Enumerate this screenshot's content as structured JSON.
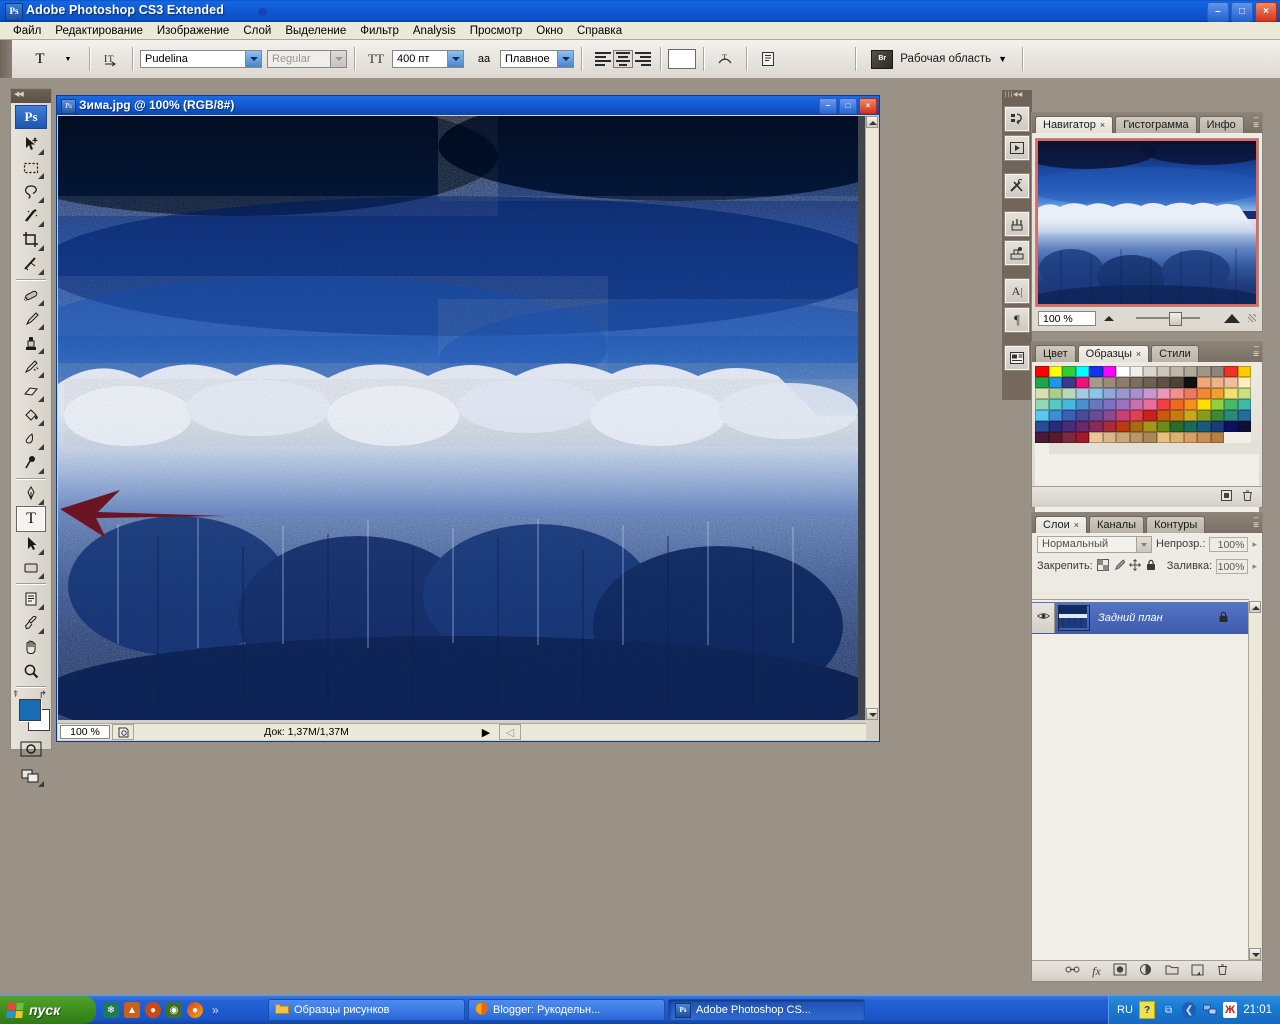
{
  "window": {
    "title": "Adobe Photoshop CS3 Extended",
    "logo": "Ps",
    "minimize": "–",
    "maximize": "□",
    "close": "×"
  },
  "menubar": {
    "items": [
      {
        "label": "Файл"
      },
      {
        "label": "Редактирование"
      },
      {
        "label": "Изображение"
      },
      {
        "label": "Слой"
      },
      {
        "label": "Выделение"
      },
      {
        "label": "Фильтр"
      },
      {
        "label": "Analysis"
      },
      {
        "label": "Просмотр"
      },
      {
        "label": "Окно"
      },
      {
        "label": "Справка"
      }
    ]
  },
  "options_bar": {
    "tool_icon": "T",
    "tool_dropdown_arrow": "▼",
    "orientation_icon": "text-orientation",
    "font_family": "Pudelina",
    "font_style": "Regular",
    "size_icon": "TT",
    "font_size": "400 пт",
    "antialias_icon": "aa",
    "antialias": "Плавное",
    "align_left": "align-left",
    "align_center": "align-center",
    "align_right": "align-right",
    "color_swatch": "#ffffff",
    "warp_icon": "warp-text",
    "palette_icon": "character-palette",
    "bridge_icon": "Br",
    "workspace_label": "Рабочая область",
    "workspace_arrow": "▼"
  },
  "toolbox": {
    "logo": "Ps",
    "tools": [
      {
        "name": "move-tool",
        "glyph": "⬈",
        "selected": false,
        "group": 0
      },
      {
        "name": "marquee-tool",
        "glyph": "⬚",
        "selected": false,
        "group": 0
      },
      {
        "name": "lasso-tool",
        "glyph": "⥁",
        "selected": false,
        "group": 0
      },
      {
        "name": "magic-wand-tool",
        "glyph": "✱",
        "selected": false,
        "group": 0
      },
      {
        "name": "crop-tool",
        "glyph": "⯀",
        "selected": false,
        "group": 0
      },
      {
        "name": "slice-tool",
        "glyph": "∕",
        "selected": false,
        "group": 0
      },
      {
        "name": "healing-brush-tool",
        "glyph": "✒",
        "selected": false,
        "group": 1
      },
      {
        "name": "brush-tool",
        "glyph": "✎",
        "selected": false,
        "group": 1
      },
      {
        "name": "clone-stamp-tool",
        "glyph": "⎘",
        "selected": false,
        "group": 1
      },
      {
        "name": "history-brush-tool",
        "glyph": "✍",
        "selected": false,
        "group": 1
      },
      {
        "name": "eraser-tool",
        "glyph": "▱",
        "selected": false,
        "group": 1
      },
      {
        "name": "gradient-tool",
        "glyph": "◨",
        "selected": false,
        "group": 1
      },
      {
        "name": "blur-tool",
        "glyph": "◖",
        "selected": false,
        "group": 1
      },
      {
        "name": "dodge-tool",
        "glyph": "⚫",
        "selected": false,
        "group": 1
      },
      {
        "name": "pen-tool",
        "glyph": "✑",
        "selected": false,
        "group": 2
      },
      {
        "name": "type-tool",
        "glyph": "T",
        "selected": true,
        "group": 2
      },
      {
        "name": "path-selection-tool",
        "glyph": "➤",
        "selected": false,
        "group": 2
      },
      {
        "name": "rectangle-tool",
        "glyph": "▭",
        "selected": false,
        "group": 2
      },
      {
        "name": "notes-tool",
        "glyph": "Ὕ2",
        "selected": false,
        "group": 3
      },
      {
        "name": "eyedropper-tool",
        "glyph": "⚗",
        "selected": false,
        "group": 3
      },
      {
        "name": "hand-tool",
        "glyph": "✋",
        "selected": false,
        "group": 3
      },
      {
        "name": "zoom-tool",
        "glyph": "⚲",
        "selected": false,
        "group": 3
      }
    ],
    "foreground_color": "#1a6cb5",
    "background_color": "#ffffff",
    "quickmask_icon": "quick-mask-mode",
    "screenmode_icon": "screen-mode"
  },
  "document": {
    "title": "Зима.jpg @ 100% (RGB/8#)",
    "icon": "Ps",
    "minimize": "–",
    "restore": "□",
    "close": "×",
    "zoom": "100 %",
    "doc_info": "Док: 1,37M/1,37M",
    "play_arrow": "▶",
    "image_alt": "winter-forest-photo"
  },
  "dock_strip": {
    "collapse_icon": "◀◀",
    "buttons": [
      {
        "name": "history-panel-icon",
        "glyph": "↺"
      },
      {
        "name": "actions-panel-icon",
        "glyph": "▶"
      },
      {
        "name": "tool-presets-panel-icon",
        "glyph": "✂"
      },
      {
        "name": "brushes-panel-icon",
        "glyph": "⚘"
      },
      {
        "name": "clone-source-panel-icon",
        "glyph": "⚒"
      },
      {
        "name": "character-panel-icon",
        "glyph": "A"
      },
      {
        "name": "paragraph-panel-icon",
        "glyph": "¶"
      },
      {
        "name": "layer-comps-panel-icon",
        "glyph": "▤"
      }
    ]
  },
  "navigator_panel": {
    "tabs": [
      {
        "label": "Навигатор",
        "active": true,
        "close": "×"
      },
      {
        "label": "Гистограмма",
        "active": false,
        "close": ""
      },
      {
        "label": "Инфо",
        "active": false,
        "close": ""
      }
    ],
    "zoom_value": "100 %",
    "menu_icon": "≡",
    "minimize_icon": "–",
    "close_icon": "×",
    "view_box_color": "#e8645a"
  },
  "swatches_panel": {
    "tabs": [
      {
        "label": "Цвет",
        "active": false,
        "close": ""
      },
      {
        "label": "Образцы",
        "active": true,
        "close": "×"
      },
      {
        "label": "Стили",
        "active": false,
        "close": ""
      }
    ],
    "menu_icon": "≡",
    "minimize_icon": "–",
    "close_icon": "×",
    "new_swatch_icon": "▣",
    "delete_swatch_icon": "Ὕ1",
    "colors": [
      "#ff0000",
      "#ffff00",
      "#33cc33",
      "#00ffff",
      "#1133ee",
      "#ff00ff",
      "#ffffff",
      "#f2f0ec",
      "#dcd7cd",
      "#cdc7bb",
      "#beb7aa",
      "#b0a89a",
      "#9f968a",
      "#8e857a",
      "#ee3322",
      "#ffcc00",
      "#1aa84a",
      "#2196e8",
      "#3a3a8c",
      "#ee1177",
      "#a89a8a",
      "#9a8b7c",
      "#8b7c6d",
      "#7d6e5f",
      "#6f6152",
      "#5f5244",
      "#4d4238",
      "#101010",
      "#f0a878",
      "#eeb288",
      "#eebf9a",
      "#fff0b8",
      "#d8dfb0",
      "#a8cf90",
      "#b8d8b8",
      "#a8c8e0",
      "#8fc4ea",
      "#8fa8d8",
      "#9898cc",
      "#a890cc",
      "#c898cc",
      "#e898b8",
      "#f09090",
      "#f07860",
      "#f0883a",
      "#f0a030",
      "#f0e070",
      "#c8e080",
      "#8fd8b8",
      "#58c8c0",
      "#48b8e0",
      "#4890d0",
      "#6878c0",
      "#8070c0",
      "#a070c0",
      "#c870b0",
      "#e87098",
      "#f04040",
      "#f06820",
      "#f89020",
      "#ffe000",
      "#90d040",
      "#48b868",
      "#40b8a8",
      "#58c8f0",
      "#3a8fd8",
      "#3a5fb8",
      "#4a4a9a",
      "#6a4a9a",
      "#8a4a90",
      "#c8407a",
      "#e04050",
      "#cc2020",
      "#c85a10",
      "#c87a10",
      "#c8a820",
      "#8a9a20",
      "#3a8a3a",
      "#2a8a7a",
      "#2a6a9a",
      "#2a4a9a",
      "#2a2a7a",
      "#4a2a7a",
      "#6a2a6a",
      "#8a2a5a",
      "#a82a3a",
      "#b83a10",
      "#a86a10",
      "#a8941a",
      "#6a8a1a",
      "#2a6a2a",
      "#1a6a5a",
      "#1a5a7a",
      "#1a3a7a",
      "#101060",
      "#100f3a",
      "#4a1a3a",
      "#5a1a2a",
      "#7a2a3a",
      "#a01a2a",
      "#e8c89a",
      "#d8b888",
      "#c8a878",
      "#b89868",
      "#a88858",
      "#e8c080",
      "#e0b070",
      "#d8a060",
      "#c89050",
      "#b88040",
      "",
      "",
      ""
    ]
  },
  "layers_panel": {
    "tabs": [
      {
        "label": "Слои",
        "active": true,
        "close": "×"
      },
      {
        "label": "Каналы",
        "active": false,
        "close": ""
      },
      {
        "label": "Контуры",
        "active": false,
        "close": ""
      }
    ],
    "menu_icon": "≡",
    "minimize_icon": "–",
    "close_icon": "×",
    "blend_mode": "Нормальный",
    "opacity_label": "Непрозр.:",
    "opacity_value": "100%",
    "lock_label": "Закрепить:",
    "lock_icons": [
      "▨",
      "✎",
      "✛",
      "ὑ2"
    ],
    "fill_label": "Заливка:",
    "fill_value": "100%",
    "layers": [
      {
        "name": "Задний план",
        "visible_icon": "◉",
        "locked_icon": "ὑ2",
        "selected": true
      }
    ],
    "footer_buttons": [
      {
        "name": "link-layers-button",
        "glyph": "⚭"
      },
      {
        "name": "layer-style-button",
        "glyph": "fx"
      },
      {
        "name": "add-mask-button",
        "glyph": "□"
      },
      {
        "name": "adjustment-layer-button",
        "glyph": "◐"
      },
      {
        "name": "new-group-button",
        "glyph": "❐"
      },
      {
        "name": "new-layer-button",
        "glyph": "❐"
      },
      {
        "name": "delete-layer-button",
        "glyph": "Ὕ1"
      }
    ]
  },
  "annotation": {
    "shape": "left-pointing-arrow",
    "color": "#6b1424",
    "target": "type-tool"
  },
  "taskbar": {
    "start_label": "пуск",
    "quick_launch": [
      {
        "name": "quicklaunch-icon-1",
        "glyph": "❄",
        "color": "#8fe0c0"
      },
      {
        "name": "quicklaunch-icon-2",
        "glyph": "▲",
        "color": "#e08a3a"
      },
      {
        "name": "quicklaunch-icon-3",
        "glyph": "●",
        "color": "#d85a1a"
      },
      {
        "name": "quicklaunch-icon-4",
        "glyph": "◉",
        "color": "#4a7a3a"
      },
      {
        "name": "quicklaunch-icon-5",
        "glyph": "●",
        "color": "#d8401a"
      }
    ],
    "overflow_chevron": "»",
    "tasks": [
      {
        "label": "Образцы рисунков",
        "icon": "folder-icon",
        "active": false
      },
      {
        "label": "Blogger: Рукодельн...",
        "icon": "browser-icon",
        "active": false
      },
      {
        "label": "Adobe Photoshop CS...",
        "icon": "Ps",
        "active": true
      }
    ],
    "tray": {
      "language": "RU",
      "icons": [
        {
          "name": "help-tray-icon",
          "glyph": "?"
        },
        {
          "name": "updates-tray-icon",
          "glyph": "⧉"
        },
        {
          "name": "show-hidden-icons",
          "glyph": "❮"
        },
        {
          "name": "network-tray-icon",
          "glyph": "▣"
        },
        {
          "name": "antivirus-tray-icon",
          "glyph": "Ж"
        }
      ],
      "clock": "21:01"
    }
  }
}
